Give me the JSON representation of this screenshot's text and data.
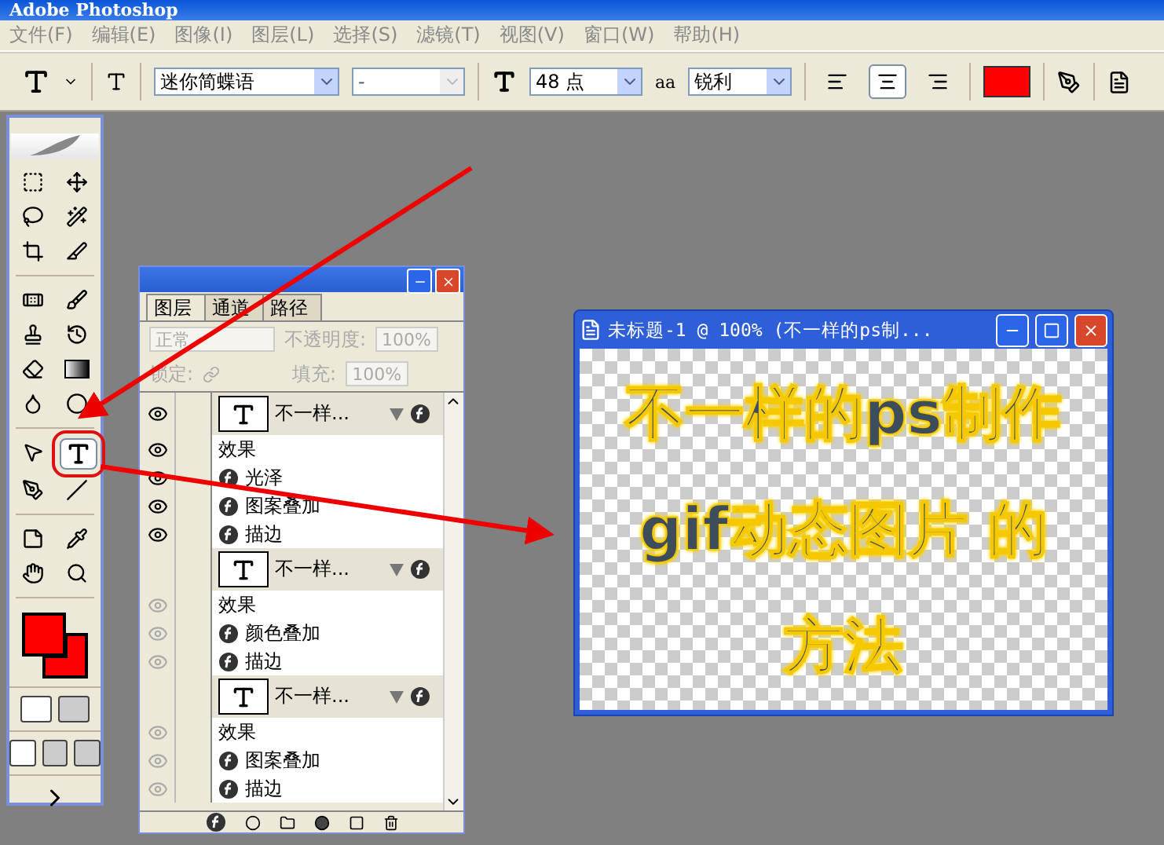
{
  "window": {
    "title": "Adobe Photoshop"
  },
  "menu": [
    "文件(F)",
    "编辑(E)",
    "图像(I)",
    "图层(L)",
    "选择(S)",
    "滤镜(T)",
    "视图(V)",
    "窗口(W)",
    "帮助(H)"
  ],
  "options": {
    "font_family": "迷你简蝶语",
    "font_style": "-",
    "font_size": "48 点",
    "antialias_label": "aa",
    "antialias": "锐利",
    "align": [
      {
        "kind": "left",
        "selected": false
      },
      {
        "kind": "center",
        "selected": true
      },
      {
        "kind": "right",
        "selected": false
      }
    ]
  },
  "toolbox": {
    "groups": [
      [
        {
          "kind": "marquee",
          "selected": false
        },
        {
          "kind": "move",
          "selected": false
        },
        {
          "kind": "lasso",
          "selected": false
        },
        {
          "kind": "wand",
          "selected": false
        },
        {
          "kind": "crop",
          "selected": false
        },
        {
          "kind": "slice",
          "selected": false
        }
      ],
      [
        {
          "kind": "healing",
          "selected": false
        },
        {
          "kind": "brush",
          "selected": false
        },
        {
          "kind": "stamp",
          "selected": false
        },
        {
          "kind": "history",
          "selected": false
        },
        {
          "kind": "eraser",
          "selected": false
        },
        {
          "kind": "gradient",
          "selected": false
        },
        {
          "kind": "blur",
          "selected": false
        },
        {
          "kind": "dodge",
          "selected": false
        }
      ],
      [
        {
          "kind": "path",
          "selected": false
        },
        {
          "kind": "type",
          "selected": true
        },
        {
          "kind": "pen",
          "selected": false
        },
        {
          "kind": "line",
          "selected": false
        }
      ],
      [
        {
          "kind": "notes",
          "selected": false
        },
        {
          "kind": "eyedropper",
          "selected": false
        },
        {
          "kind": "hand",
          "selected": false
        },
        {
          "kind": "zoom",
          "selected": false
        }
      ]
    ]
  },
  "layers_panel": {
    "tabs": [
      {
        "label": "图层",
        "selected": true
      },
      {
        "label": "通道",
        "selected": false
      },
      {
        "label": "路径",
        "selected": false
      }
    ],
    "blend_mode": "正常",
    "opacity_label": "不透明度:",
    "opacity": "100%",
    "lock_label": "锁定:",
    "fill_label": "填充:",
    "fill": "100%",
    "layers": [
      {
        "name": "不一样...",
        "visible": true,
        "effects_label": "效果",
        "effects": [
          {
            "name": "光泽",
            "visible": true
          },
          {
            "name": "图案叠加",
            "visible": true
          },
          {
            "name": "描边",
            "visible": true
          }
        ]
      },
      {
        "name": "不一样...",
        "visible": false,
        "effects_label": "效果",
        "effects": [
          {
            "name": "颜色叠加",
            "visible": true
          },
          {
            "name": "描边",
            "visible": true
          }
        ]
      },
      {
        "name": "不一样...",
        "visible": false,
        "effects_label": "效果",
        "effects": [
          {
            "name": "图案叠加",
            "visible": true
          },
          {
            "name": "描边",
            "visible": true
          }
        ]
      }
    ]
  },
  "document": {
    "title": "未标题-1 @ 100% (不一样的ps制...",
    "lines": [
      "不一样的ps制作",
      "gif动态图片 的",
      "方法"
    ]
  }
}
